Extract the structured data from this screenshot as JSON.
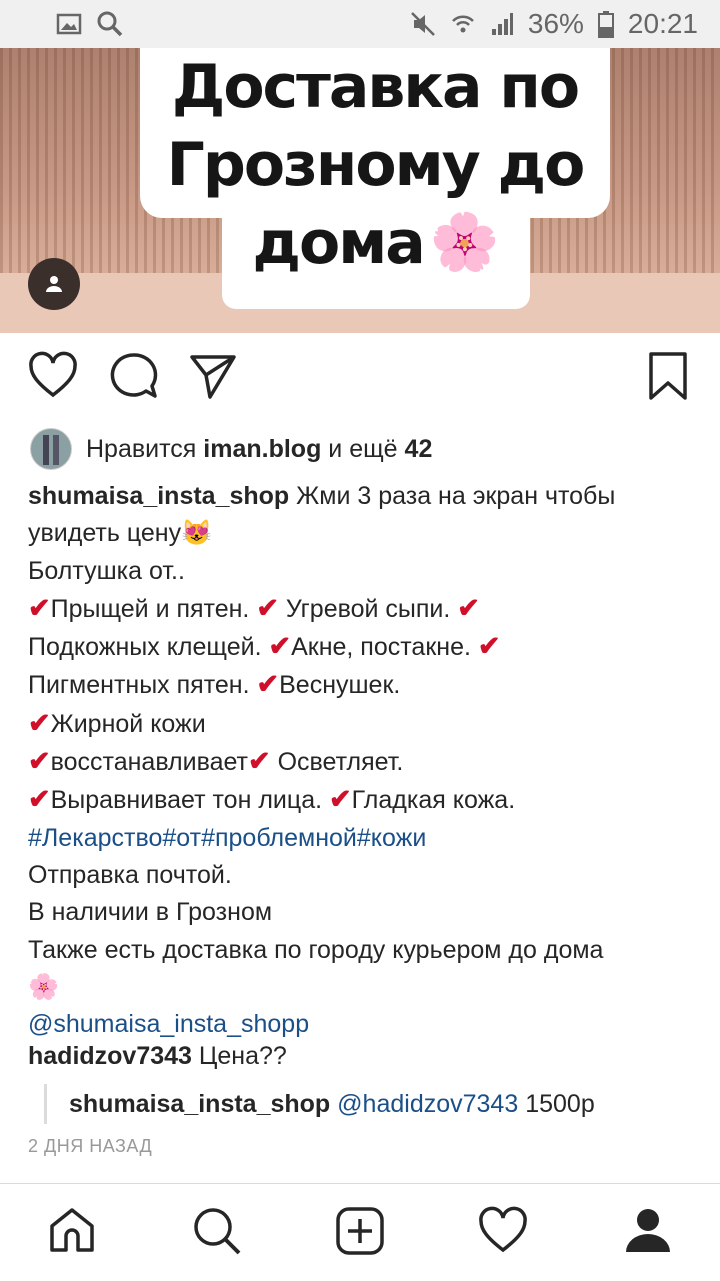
{
  "status_bar": {
    "left_icons": [
      "image-icon",
      "search-icon"
    ],
    "right_icons": [
      "mute-icon",
      "wifi-icon",
      "signal-icon",
      "battery-icon"
    ],
    "battery": "36%",
    "time": "20:21"
  },
  "post_image": {
    "headline_line1": "Доставка по",
    "headline_line2": "Грозному до",
    "headline_line3": "дома",
    "flower_emoji": "🌸"
  },
  "actions": [
    "heart-icon",
    "comment-icon",
    "share-icon",
    "bookmark-icon"
  ],
  "likes": {
    "prefix": "Нравится",
    "user": "iman.blog",
    "middle": "и ещё",
    "count": "42"
  },
  "caption": {
    "username": "shumaisa_insta_shop",
    "line1_text": "Жми 3 раза на экран чтобы",
    "line2_text": "увидеть цену",
    "cat_emoji": "😻",
    "line3": "Болтушка от..",
    "check": "✔",
    "item1": "Прыщей и пятен.",
    "item2": "Угревой сыпи.",
    "item3": "Подкожных клещей.",
    "item4": "Акне, постакне.",
    "item5": "Пигментных пятен.",
    "item6": "Веснушек.",
    "item7": "Жирной кожи",
    "item8": "восстанавливает",
    "item9": "Осветляет.",
    "item10": "Выравнивает тон лица.",
    "item11": "Гладкая кожа.",
    "hashtags": "#Лекарство#от#проблемной#кожи",
    "line_post": "Отправка почтой.",
    "line_stock": "В наличии в Грозном",
    "line_delivery": "Также есть доставка по городу курьером до дома",
    "flower_emoji": "🌸",
    "mention": "@shumaisa_insta_shopp"
  },
  "comment": {
    "username": "hadidzov7343",
    "text": "Цена??"
  },
  "reply": {
    "username": "shumaisa_insta_shop",
    "mention": "@hadidzov7343",
    "text": "1500р"
  },
  "timestamp": "2 ДНЯ НАЗАД",
  "bottom_nav": [
    "home-icon",
    "search-icon",
    "new-post-icon",
    "activity-icon",
    "profile-icon"
  ],
  "colors": {
    "link": "#1b4f88",
    "check": "#d0102a",
    "text": "#262626",
    "muted": "#999999"
  }
}
